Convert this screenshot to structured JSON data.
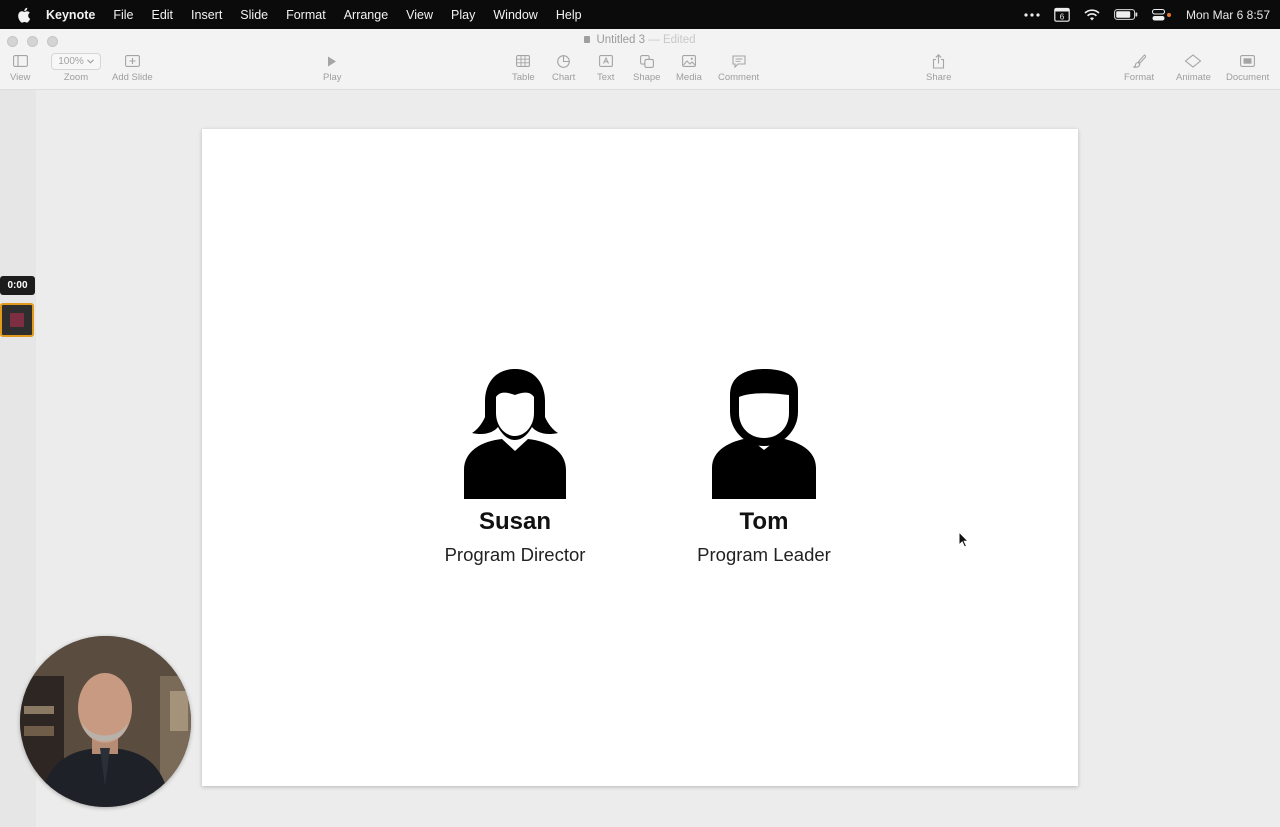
{
  "menubar": {
    "app_name": "Keynote",
    "items": [
      "File",
      "Edit",
      "Insert",
      "Slide",
      "Format",
      "Arrange",
      "View",
      "Play",
      "Window",
      "Help"
    ],
    "calendar_day": "6",
    "clock": "Mon Mar 6  8:57"
  },
  "window": {
    "title": "Untitled 3",
    "title_separator": "—",
    "title_status": "Edited"
  },
  "toolbar": {
    "view_label": "View",
    "zoom_value": "100%",
    "zoom_label": "Zoom",
    "add_slide_label": "Add Slide",
    "play_label": "Play",
    "table_label": "Table",
    "chart_label": "Chart",
    "text_label": "Text",
    "shape_label": "Shape",
    "media_label": "Media",
    "comment_label": "Comment",
    "share_label": "Share",
    "format_label": "Format",
    "animate_label": "Animate",
    "document_label": "Document"
  },
  "navigator": {
    "recording_time": "0:00"
  },
  "slide": {
    "people": [
      {
        "name": "Susan",
        "role": "Program Director",
        "icon": "woman-avatar-icon"
      },
      {
        "name": "Tom",
        "role": "Program Leader",
        "icon": "man-avatar-icon"
      }
    ]
  },
  "colors": {
    "menubar_bg": "#0b0b0b",
    "toolbar_bg": "#f3f3f3",
    "canvas_bg": "#ececec",
    "slide_bg": "#ffffff",
    "thumb_border": "#e29a1d",
    "thumb_fill": "#7d2e42"
  }
}
